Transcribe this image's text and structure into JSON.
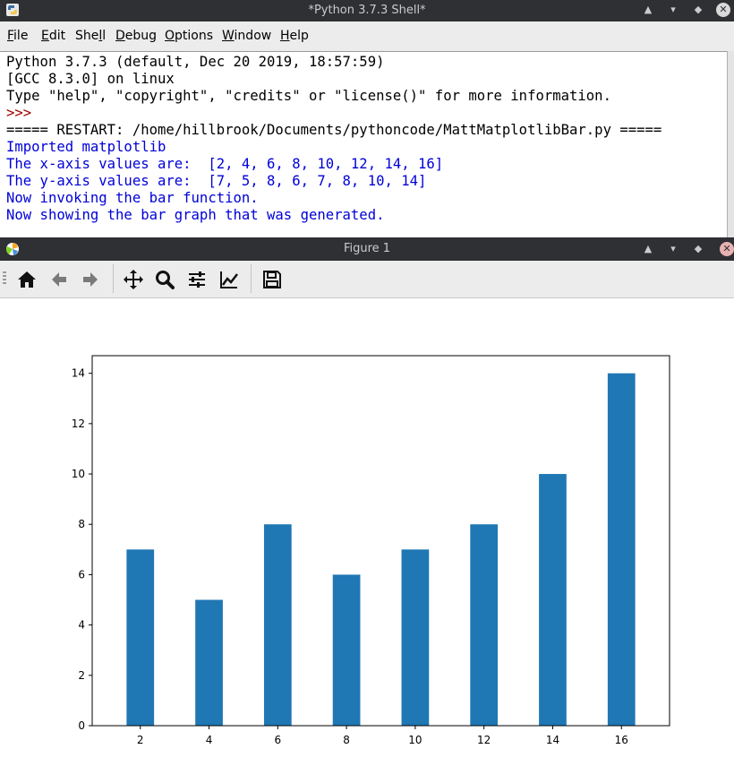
{
  "idle_window": {
    "title": "*Python 3.7.3 Shell*",
    "menu": [
      {
        "pre": "",
        "u": "F",
        "post": "ile"
      },
      {
        "pre": "",
        "u": "E",
        "post": "dit"
      },
      {
        "pre": "She",
        "u": "l",
        "post": "l"
      },
      {
        "pre": "",
        "u": "D",
        "post": "ebug"
      },
      {
        "pre": "",
        "u": "O",
        "post": "ptions"
      },
      {
        "pre": "",
        "u": "W",
        "post": "indow"
      },
      {
        "pre": "",
        "u": "H",
        "post": "elp"
      }
    ],
    "shell_lines": [
      {
        "text": "Python 3.7.3 (default, Dec 20 2019, 18:57:59)",
        "color": "#000000"
      },
      {
        "text": "[GCC 8.3.0] on linux",
        "color": "#000000"
      },
      {
        "text": "Type \"help\", \"copyright\", \"credits\" or \"license()\" for more information.",
        "color": "#000000"
      },
      {
        "text": ">>> ",
        "color": "#9a0000"
      },
      {
        "text": "===== RESTART: /home/hillbrook/Documents/pythoncode/MattMatplotlibBar.py =====",
        "color": "#000000"
      },
      {
        "text": "Imported matplotlib",
        "color": "#0000d8"
      },
      {
        "text": "The x-axis values are:  [2, 4, 6, 8, 10, 12, 14, 16]",
        "color": "#0000d8"
      },
      {
        "text": "The y-axis values are:  [7, 5, 8, 6, 7, 8, 10, 14]",
        "color": "#0000d8"
      },
      {
        "text": "Now invoking the bar function.",
        "color": "#0000d8"
      },
      {
        "text": "Now showing the bar graph that was generated.",
        "color": "#0000d8"
      }
    ]
  },
  "figure_window": {
    "title": "Figure 1",
    "toolbar": [
      "home-icon",
      "back-icon",
      "forward-icon",
      "pan-icon",
      "zoom-icon",
      "configure-subplots-icon",
      "edit-axis-icon",
      "save-icon"
    ]
  },
  "window_controls": [
    "minimize",
    "restore",
    "maximize",
    "close"
  ],
  "chart_data": {
    "type": "bar",
    "x": [
      2,
      4,
      6,
      8,
      10,
      12,
      14,
      16
    ],
    "values": [
      7,
      5,
      8,
      6,
      7,
      8,
      10,
      14
    ],
    "bar_width": 0.8,
    "color": "#1f77b4",
    "xlim": [
      0.6,
      17.4
    ],
    "ylim": [
      0,
      14.7
    ],
    "xticks": [
      2,
      4,
      6,
      8,
      10,
      12,
      14,
      16
    ],
    "yticks": [
      0,
      2,
      4,
      6,
      8,
      10,
      12,
      14
    ],
    "title": "",
    "xlabel": "",
    "ylabel": "",
    "grid": false,
    "legend": false
  }
}
